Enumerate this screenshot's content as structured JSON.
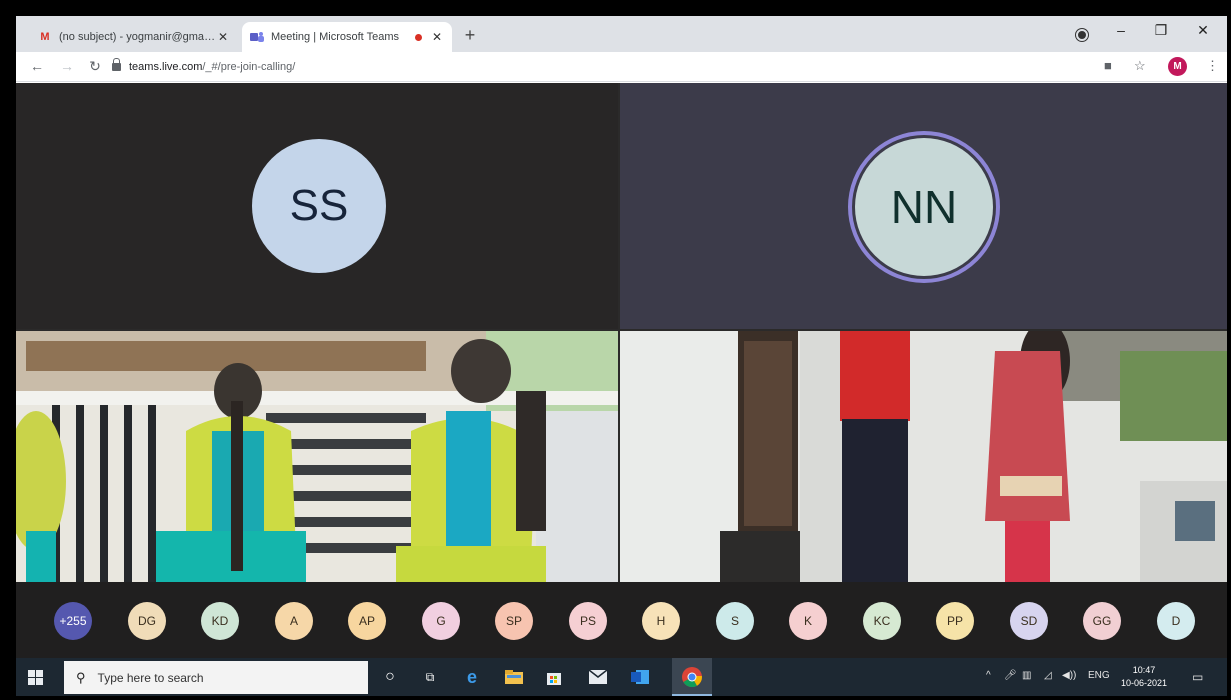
{
  "browser": {
    "tabs": [
      {
        "icon": "gmail-icon",
        "title": "(no subject) - yogmanir@gmail.c"
      },
      {
        "icon": "teams-icon",
        "title": "Meeting | Microsoft Teams"
      }
    ],
    "url_host": "teams.live.com",
    "url_path": "/_#/pre-join-calling/",
    "profile_initial": "M"
  },
  "meeting": {
    "tiles": [
      {
        "initials": "SS",
        "avatar_color": "#c4d5ea"
      },
      {
        "initials": "NN",
        "avatar_color": "#c7d8d7",
        "speaking_ring": "#8d85d6"
      }
    ],
    "participant_strip": [
      {
        "label": "+255",
        "bg": "#5558af",
        "fg": "#ffffff"
      },
      {
        "label": "DG",
        "bg": "#f0dcb8"
      },
      {
        "label": "KD",
        "bg": "#cfe6d6"
      },
      {
        "label": "A",
        "bg": "#f6d7a8"
      },
      {
        "label": "AP",
        "bg": "#f7d69f"
      },
      {
        "label": "G",
        "bg": "#f1cfe0"
      },
      {
        "label": "SP",
        "bg": "#f7c4b0"
      },
      {
        "label": "PS",
        "bg": "#f5cfd3"
      },
      {
        "label": "H",
        "bg": "#f7e2b8"
      },
      {
        "label": "S",
        "bg": "#cdeaea"
      },
      {
        "label": "K",
        "bg": "#f5cfd0"
      },
      {
        "label": "KC",
        "bg": "#d6e9d2"
      },
      {
        "label": "PP",
        "bg": "#f6e3a8"
      },
      {
        "label": "SD",
        "bg": "#d7d4ef"
      },
      {
        "label": "GG",
        "bg": "#f1cfd3"
      },
      {
        "label": "D",
        "bg": "#d4ecef"
      }
    ]
  },
  "taskbar": {
    "search_placeholder": "Type here to search",
    "lang": "ENG",
    "time": "10:47",
    "date": "10-06-2021"
  }
}
